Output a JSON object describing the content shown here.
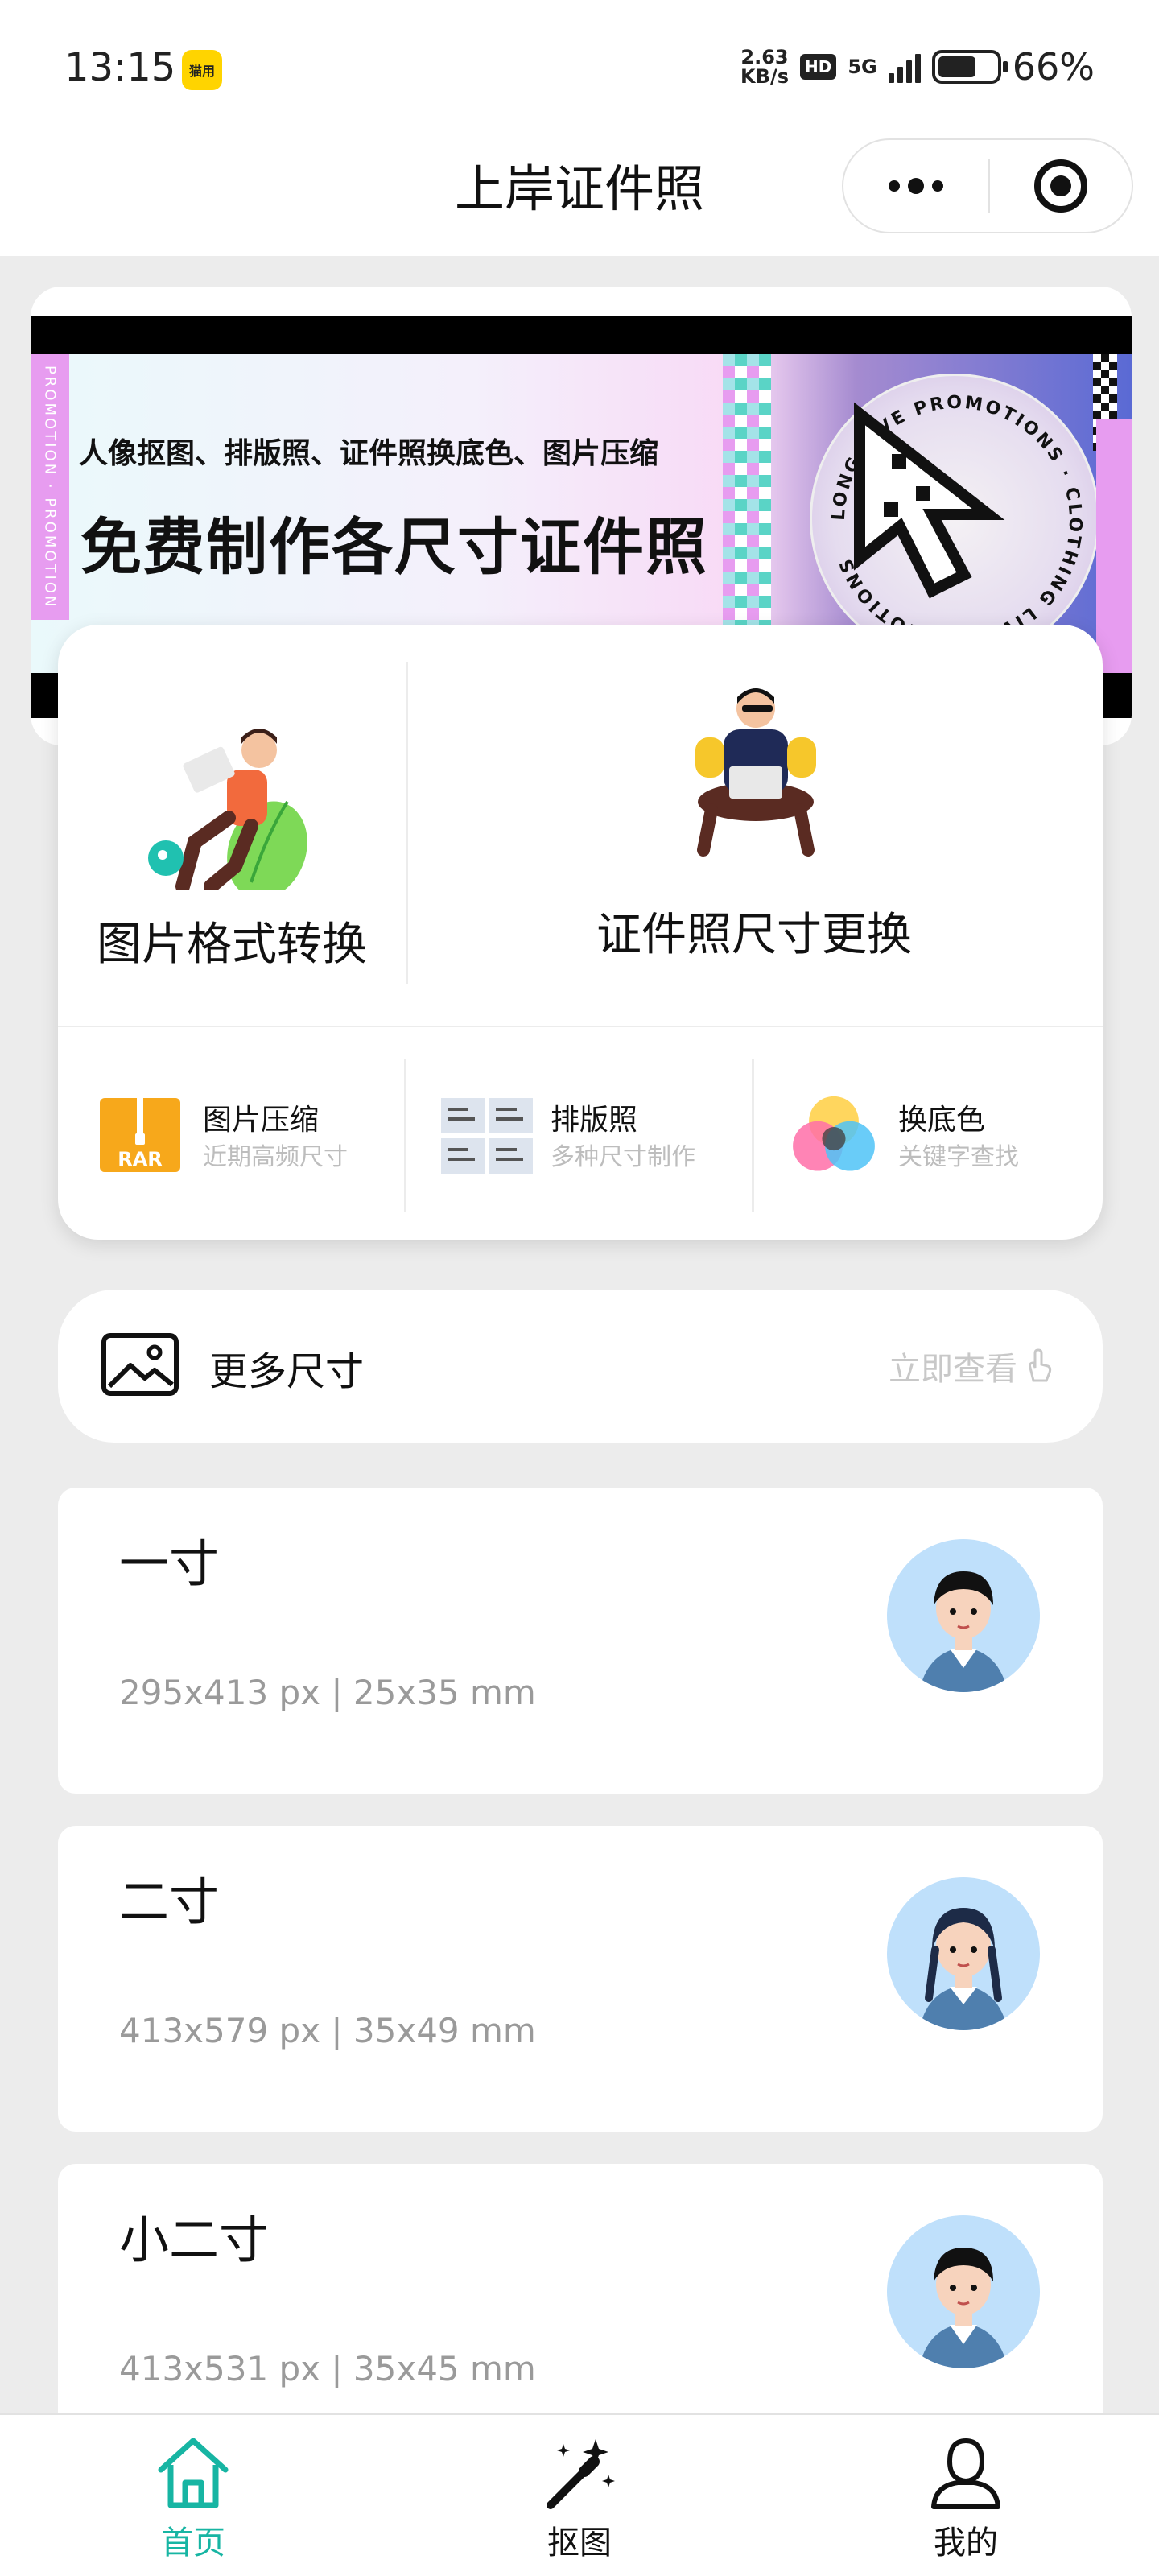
{
  "status_bar": {
    "time": "13:15",
    "app_badge": "猫用",
    "net_speed_value": "2.63",
    "net_speed_unit": "KB/s",
    "hd": "HD",
    "network": "5G",
    "battery_percent": 66,
    "battery_text": "66%"
  },
  "header": {
    "title": "上岸证件照"
  },
  "banner": {
    "subtitle": "人像抠图、排版照、证件照换底色、图片压缩",
    "title": "免费制作各尺寸证件照",
    "side_text": "PROMOTION · PROMOTION",
    "circle_text": "LONG LIVE PROMOTIONS · CLOTHING LIVE PROMOTIONS"
  },
  "features": {
    "convert_label": "图片格式转换",
    "resize_label": "证件照尺寸更换",
    "small": [
      {
        "title": "图片压缩",
        "subtitle": "近期高频尺寸",
        "icon": "rar-archive-icon",
        "icon_text": "RAR"
      },
      {
        "title": "排版照",
        "subtitle": "多种尺寸制作",
        "icon": "layout-grid-icon"
      },
      {
        "title": "换底色",
        "subtitle": "关键字查找",
        "icon": "color-circles-icon"
      }
    ]
  },
  "more_sizes": {
    "label": "更多尺寸",
    "action": "立即查看"
  },
  "size_cards": [
    {
      "name": "一寸",
      "dims": "295x413 px | 25x35 mm",
      "avatar": "boy-avatar"
    },
    {
      "name": "二寸",
      "dims": "413x579 px | 35x49 mm",
      "avatar": "girl-avatar"
    },
    {
      "name": "小二寸",
      "dims": "413x531 px | 35x45 mm",
      "avatar": "boy-avatar"
    }
  ],
  "tabs": [
    {
      "label": "首页",
      "icon": "home-icon",
      "active": true
    },
    {
      "label": "抠图",
      "icon": "magic-wand-icon",
      "active": false
    },
    {
      "label": "我的",
      "icon": "user-icon",
      "active": false
    }
  ],
  "colors": {
    "accent": "#17b5a3",
    "page_bg": "#ececec",
    "banner_pink": "#e79cf0"
  }
}
